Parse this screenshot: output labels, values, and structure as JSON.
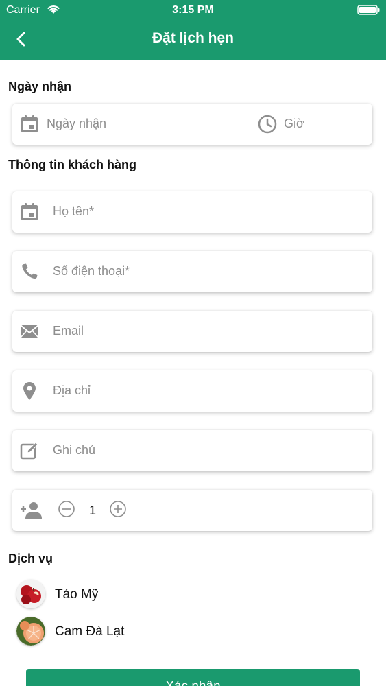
{
  "status_bar": {
    "carrier": "Carrier",
    "time": "3:15 PM"
  },
  "header": {
    "title": "Đặt lịch hẹn",
    "back_icon": "chevron-left-icon"
  },
  "receive_section": {
    "label": "Ngày nhận",
    "date_placeholder": "Ngày nhận",
    "time_placeholder": "Giờ"
  },
  "customer_section": {
    "label": "Thông tin khách hàng",
    "fields": {
      "name_placeholder": "Họ tên*",
      "phone_placeholder": "Số điện thoại*",
      "email_placeholder": "Email",
      "address_placeholder": "Địa chỉ",
      "note_placeholder": "Ghi chú"
    },
    "guests": {
      "value": "1"
    }
  },
  "services_section": {
    "label": "Dịch vụ",
    "items": [
      {
        "label": "Táo Mỹ"
      },
      {
        "label": "Cam Đà Lạt"
      }
    ]
  },
  "confirm_label": "Xác nhận",
  "colors": {
    "brand": "#1a9a6e",
    "icon_gray": "#8e8e8e"
  }
}
